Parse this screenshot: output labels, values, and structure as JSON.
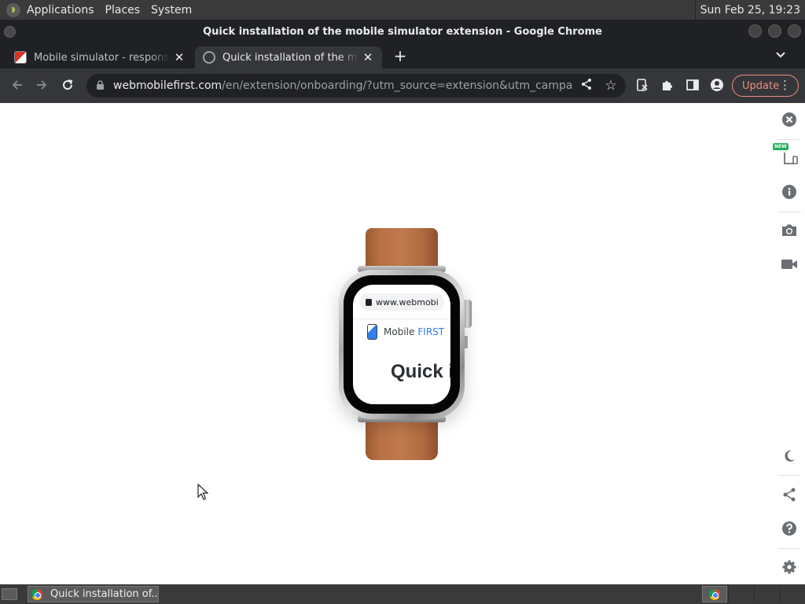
{
  "system_panel": {
    "menus": [
      "Applications",
      "Places",
      "System"
    ],
    "clock": "Sun Feb 25, 19:23"
  },
  "window": {
    "title": "Quick installation of the mobile simulator extension - Google Chrome"
  },
  "tabs": [
    {
      "label": "Mobile simulator - responsive testing tool",
      "icon": "simulator-favicon",
      "active": false
    },
    {
      "label": "Quick installation of the mobile simulator",
      "icon": "globe-icon",
      "active": true
    }
  ],
  "toolbar": {
    "url_host": "webmobilefirst.com",
    "url_path": "/en/extension/onboarding/?utm_source=extension&utm_campaign=onb...",
    "update_label": "Update"
  },
  "side_panel": {
    "new_badge": "NEW",
    "icons": [
      "close-icon",
      "devices-icon",
      "info-icon",
      "camera-icon",
      "video-icon",
      "moon-icon",
      "share-icon",
      "help-icon",
      "settings-icon"
    ]
  },
  "watch": {
    "url": "www.webmobi",
    "brand_mobile": "Mobile",
    "brand_first": "FIRST",
    "heading": "Quick i"
  },
  "taskbar": {
    "task_label": "Quick installation of..."
  },
  "colors": {
    "accent_update": "#f28b82",
    "brand_blue": "#2f80ed",
    "strap": "#b97145"
  }
}
